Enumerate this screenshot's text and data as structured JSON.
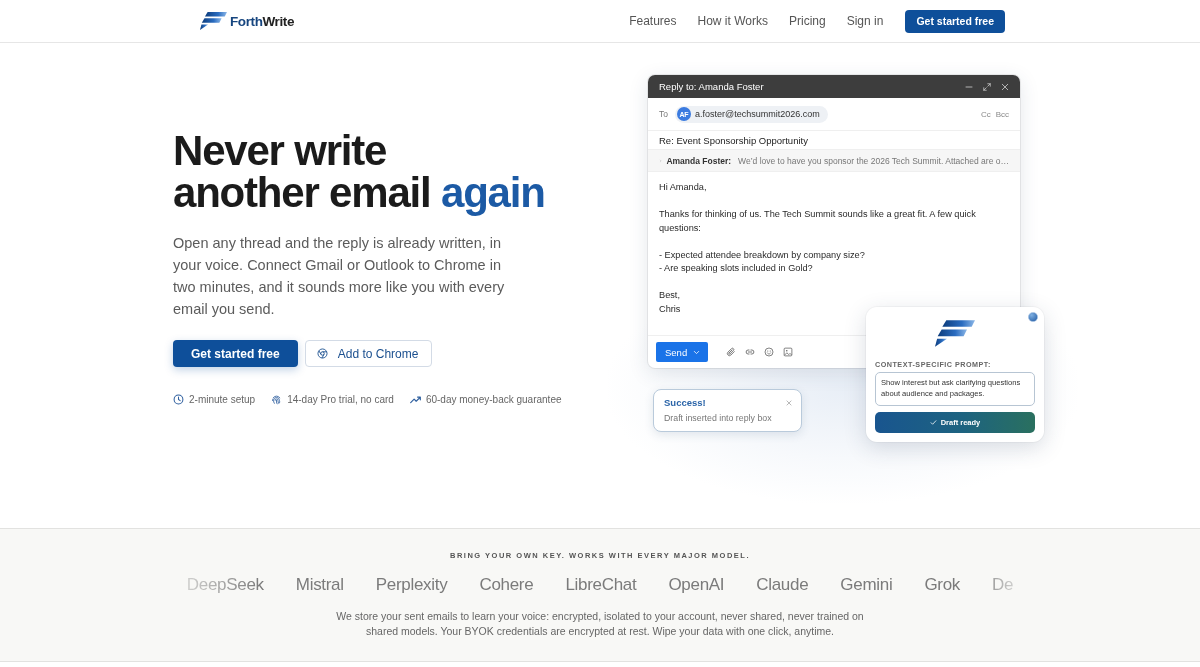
{
  "header": {
    "logo": {
      "part_1": "Forth",
      "part_2": "Write"
    },
    "nav": [
      "Features",
      "How it Works",
      "Pricing",
      "Sign in"
    ],
    "cta": "Get started free"
  },
  "hero": {
    "headline": {
      "lines": [
        "Never write",
        "another email"
      ],
      "accent": "again"
    },
    "intro": "Open any thread and the reply is already written, in your voice. Connect Gmail or Outlook to Chrome in two minutes, and it sounds more like you with every email you send.",
    "buttons": [
      {
        "kind": "primary",
        "label": "Get started free"
      },
      {
        "kind": "browser",
        "label": "Add to Chrome"
      }
    ],
    "perks": [
      {
        "kind": "clock",
        "label": "2-minute setup"
      },
      {
        "kind": "fingerprint",
        "label": "14-day Pro trial, no card"
      },
      {
        "kind": "trend",
        "label": "60-day money-back guarantee"
      }
    ]
  },
  "reply_window": {
    "title": "Reply to: Amanda Foster",
    "to_label": "To",
    "recipient": {
      "initials": "AF",
      "email": "a.foster@techsummit2026.com"
    },
    "cc": "Cc",
    "bcc": "Bcc",
    "subject": "Re: Event Sponsorship Opportunity",
    "quoted": {
      "sender": "Amanda Foster:",
      "snippet": "We’d love to have you sponsor the 2026 Tech Summit. Attached are o…"
    },
    "body": [
      [
        "Hi Amanda,"
      ],
      [
        "Thanks for thinking of us. The Tech Summit sounds like a great fit. A few quick questions:"
      ],
      [
        "- Expected attendee breakdown by company size?",
        "- Are speaking slots included in Gold?"
      ],
      [
        "Best,",
        "Chris"
      ]
    ],
    "send_label": "Send"
  },
  "toast": {
    "title": "Success!",
    "message": "Draft inserted into reply box"
  },
  "assistant_card": {
    "prompt_label": "CONTEXT-SPECIFIC PROMPT:",
    "prompt": "Show interest but ask clarifying questions about audience and packages.",
    "action": "Draft ready"
  },
  "models_strip": {
    "caption": "BRING YOUR OWN KEY. WORKS WITH EVERY MAJOR MODEL.",
    "models": [
      "DeepSeek",
      "Mistral",
      "Perplexity",
      "Cohere",
      "LibreChat",
      "OpenAI",
      "Claude",
      "Gemini",
      "Grok",
      "De"
    ],
    "privacy_note": "We store your sent emails to learn your voice: encrypted, isolated to your account, never shared, never trained on shared models. Your BYOK credentials are encrypted at rest. Wipe your data with one click, anytime."
  }
}
